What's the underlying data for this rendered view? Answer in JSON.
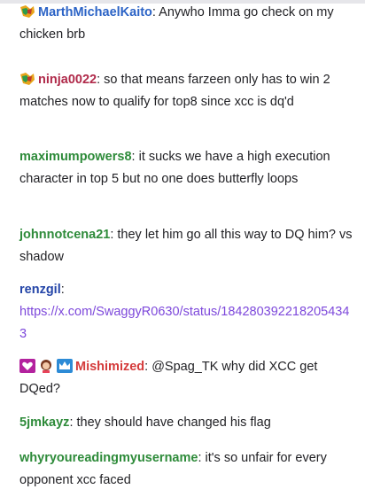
{
  "colors": {
    "MarthMichaelKaito": "#2b63c6",
    "ninja0022": "#b02a4a",
    "maximumpowers8": "#2e8b3a",
    "johnnotcena21": "#2e8b3a",
    "renzgil": "#2445a8",
    "Mishimized": "#d43a3a",
    "5jmkayz": "#2e8b3a",
    "whyryoureadingmyusername": "#2e8b3a",
    "link": "#7d48db"
  },
  "messages": [
    {
      "user": "MarthMichaelKaito",
      "text": " Anywho Imma go check on my chicken brb",
      "badges": [
        "game-badge-icon"
      ]
    },
    {
      "user": "ninja0022",
      "text": " so that means farzeen only has to win 2 matches now to qualify for top8 since xcc is dq'd",
      "badges": [
        "game-badge-icon"
      ]
    },
    {
      "user": "maximumpowers8",
      "text": " it sucks we have a high execution character in top 5 but no one does butterfly loops",
      "badges": []
    },
    {
      "user": "johnnotcena21",
      "text": " they let him go all this way to DQ him? vs shadow",
      "badges": []
    },
    {
      "user": "renzgil",
      "text": "",
      "link": "https://x.com/SwaggyR0630/status/1842803922182054343",
      "badges": []
    },
    {
      "user": "Mishimized",
      "text": " @Spag_TK why did XCC get DQed?",
      "badges": [
        "subscriber-heart-icon",
        "avatar-badge-icon",
        "crown-badge-icon"
      ]
    },
    {
      "user": "5jmkayz",
      "text": " they should have changed his flag",
      "badges": []
    },
    {
      "user": "whyryoureadingmyusername",
      "text": " it's so unfair for every opponent xcc faced",
      "badges": []
    }
  ]
}
